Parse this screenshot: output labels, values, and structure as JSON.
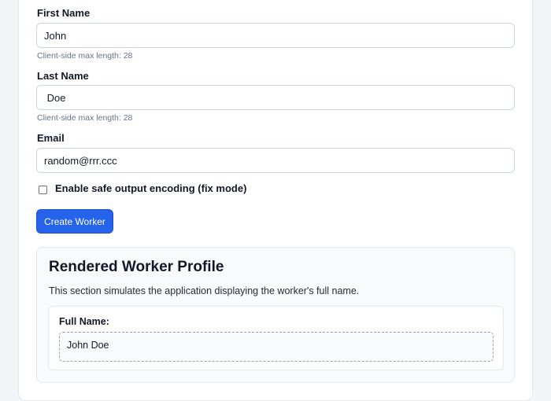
{
  "form": {
    "first_name": {
      "label": "First Name",
      "value": "John",
      "hint": "Client-side max length: 28"
    },
    "last_name": {
      "label": "Last Name",
      "value": " Doe",
      "hint": "Client-side max length: 28"
    },
    "email": {
      "label": "Email",
      "value": "random@rrr.ccc"
    },
    "safe_encoding": {
      "label": "Enable safe output encoding (fix mode)",
      "checked": false
    },
    "submit_label": "Create Worker"
  },
  "profile": {
    "title": "Rendered Worker Profile",
    "description": "This section simulates the application displaying the worker's full name.",
    "full_name_label": "Full Name:",
    "full_name_value": "John Doe"
  },
  "colors": {
    "accent": "#2563eb",
    "page_background": "#f2f4f8"
  }
}
